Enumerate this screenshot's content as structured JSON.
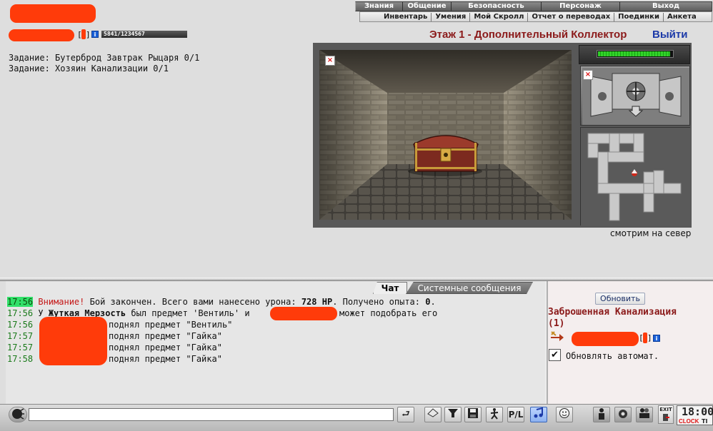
{
  "nav": {
    "row1": [
      {
        "label": "Знания",
        "w": 66
      },
      {
        "label": "Общение",
        "w": 68
      },
      {
        "label": "Безопасность",
        "w": 126
      },
      {
        "label": "Персонаж",
        "w": 110
      },
      {
        "label": "Выход",
        "w": 130
      }
    ],
    "row2": [
      "Инвентарь",
      "Умения",
      "Мой Скролл",
      "Отчет о переводах",
      "Поединки",
      "Анкета"
    ]
  },
  "player": {
    "exp": "5841/1234567",
    "info_glyph": "i"
  },
  "tasks": [
    "Задание: Бутерброд Завтрак Рыцаря 0/1",
    "Задание: Хозяин Канализации 0/1"
  ],
  "location": {
    "title": "Этаж 1 - Дополнительный Коллектор",
    "logout": "Выйти"
  },
  "view": {
    "facing": "смотрим на север",
    "broken_glyph": "×",
    "health_fill": 0.97
  },
  "chat": {
    "tabs": {
      "chat": "Чат",
      "system": "Системные сообщения"
    },
    "lines": [
      {
        "time": "17:56",
        "parts": [
          {
            "t": "Внимание!",
            "c": "warn"
          },
          {
            "t": " Бой закончен. Всего вами нанесено урона: ",
            "c": ""
          },
          {
            "t": "728 HP",
            "c": "bold"
          },
          {
            "t": ". Получено опыта: ",
            "c": ""
          },
          {
            "t": "0",
            "c": "bold"
          },
          {
            "t": ".",
            "c": ""
          }
        ]
      },
      {
        "time": "17:56",
        "parts": [
          {
            "t": "У ",
            "c": ""
          },
          {
            "t": "Жуткая Мерзость",
            "c": "bold"
          },
          {
            "t": " был предмет 'Вентиль' и",
            "c": ""
          }
        ],
        "after": "может подобрать его"
      },
      {
        "time": "17:56",
        "text": "поднял предмет \"Вентиль\""
      },
      {
        "time": "17:57",
        "text": "поднял предмет \"Гайка\""
      },
      {
        "time": "17:57",
        "text": "поднял предмет \"Гайка\""
      },
      {
        "time": "17:58",
        "text": "поднял предмет \"Гайка\""
      }
    ]
  },
  "room": {
    "refresh": "Обновить",
    "name": "Заброшенная Канализация",
    "count": "(1)",
    "auto_label": "Обновлять автомат.",
    "auto_checked": "✔"
  },
  "clock": {
    "time": "18:00",
    "label": "CLOCK",
    "label2": "TI",
    "exit": "EXIT"
  },
  "colors": {
    "accent_red": "#8b1a1a",
    "link_blue": "#1c3aa8",
    "timestamp_green": "#1a7a1a",
    "redaction": "#ff3b0a"
  }
}
